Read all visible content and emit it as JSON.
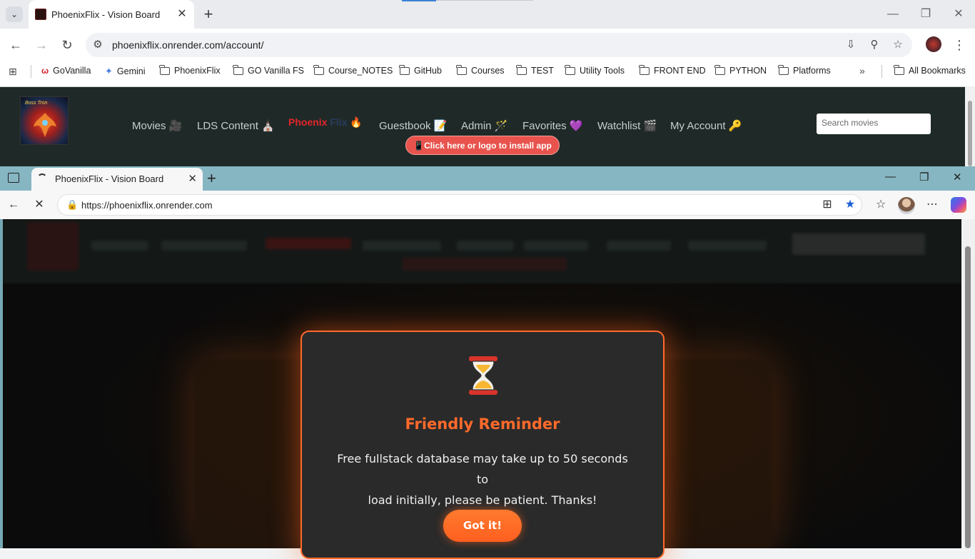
{
  "chrome": {
    "tab_title": "PhoenixFlix - Vision Board",
    "url": "phoenixflix.onrender.com/account/",
    "bookmarks": [
      "GoVanilla",
      "Gemini",
      "PhoenixFlix",
      "GO Vanilla FS",
      "Course_NOTES",
      "GitHub",
      "Courses",
      "TEST",
      "Utility Tools",
      "FRONT END",
      "PYTHON",
      "Platforms"
    ],
    "all_bookmarks": "All Bookmarks"
  },
  "site": {
    "logo_text": "Boss Tron",
    "nav": [
      {
        "label": "Movies 🎥"
      },
      {
        "label": "LDS Content ⛪"
      },
      {
        "label": "Guestbook 📝"
      },
      {
        "label": "Admin 🪄"
      },
      {
        "label": "Favorites 💜"
      },
      {
        "label": "Watchlist 🎬"
      },
      {
        "label": "My Account 🔑"
      }
    ],
    "brand": {
      "phoenix": "Phoenix",
      "flix": "Flix",
      "emoji": "🔥"
    },
    "search_placeholder": "Search movies",
    "install_label": "📱Click here or logo to install app"
  },
  "edge": {
    "tab_title": "PhoenixFlix - Vision Board",
    "url": "https://phoenixflix.onrender.com"
  },
  "modal": {
    "icon": "hourglass-icon",
    "title": "Friendly Reminder",
    "message_line1": "Free fullstack database may take up to 50 seconds to",
    "message_line2": "load initially, please be patient. Thanks!",
    "button_label": "Got it!"
  },
  "colors": {
    "accent": "#ff6a2b",
    "site_header": "#1f2a28",
    "install_button": "#e8534d",
    "edge_frame": "#86b6c2"
  }
}
